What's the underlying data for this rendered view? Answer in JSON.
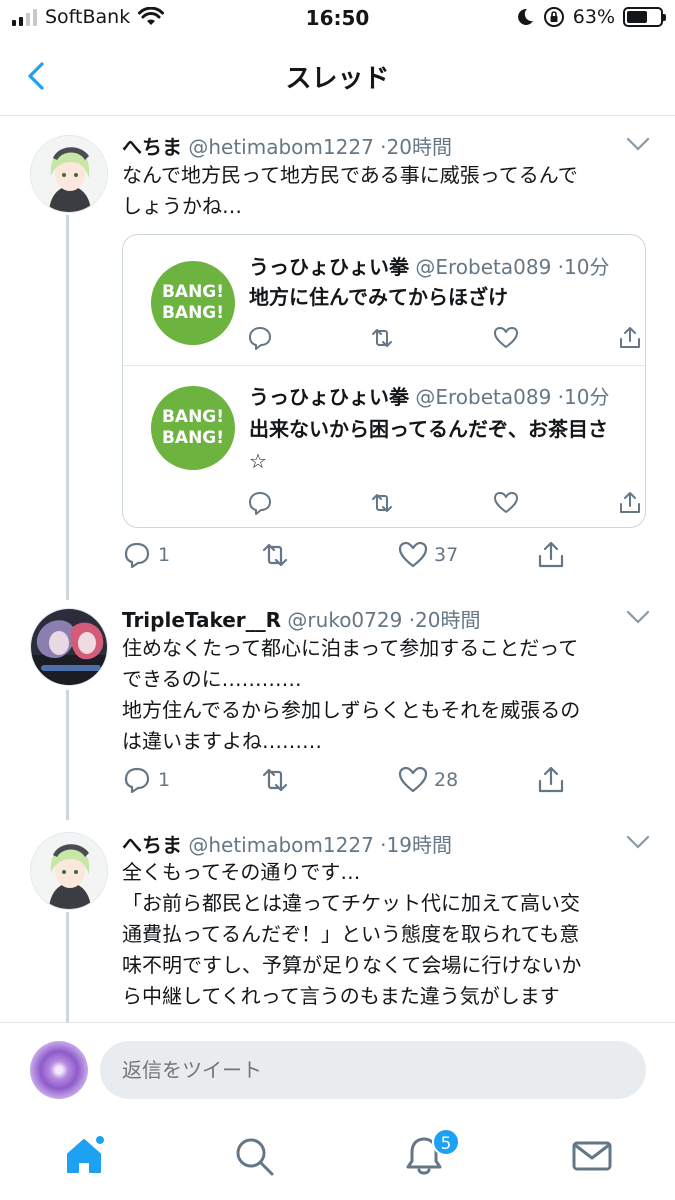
{
  "status_bar": {
    "carrier": "SoftBank",
    "time": "16:50",
    "battery": "63%",
    "battery_level": 0.63
  },
  "nav": {
    "title": "スレッド"
  },
  "tweets": [
    {
      "name": "へちま",
      "handle": "@hetimabom1227",
      "time": "20時間",
      "lines": [
        "なんで地方民って地方民である事に威張ってるんで",
        "しょうかね…"
      ],
      "replies": "1",
      "likes": "37",
      "quotes": [
        {
          "avatar_text": [
            "BANG!",
            "BANG!"
          ],
          "name": "うっひょひょい拳",
          "handle": "@Erobeta089",
          "time": "10分",
          "lines": [
            "地方に住んでみてからほざけ"
          ]
        },
        {
          "avatar_text": [
            "BANG!",
            "BANG!"
          ],
          "name": "うっひょひょい拳",
          "handle": "@Erobeta089",
          "time": "10分",
          "lines": [
            "出来ないから困ってるんだぞ、お茶目さ",
            "☆"
          ]
        }
      ]
    },
    {
      "name": "TripleTaker__R",
      "handle": "@ruko0729",
      "time": "20時間",
      "lines": [
        "住めなくたって都心に泊まって参加することだって",
        "できるのに…………",
        "地方住んでるから参加しずらくともそれを威張るの",
        "は違いますよね………"
      ],
      "replies": "1",
      "likes": "28"
    },
    {
      "name": "へちま",
      "handle": "@hetimabom1227",
      "time": "19時間",
      "lines": [
        "全くもってその通りです…",
        "「お前ら都民とは違ってチケット代に加えて高い交",
        "通費払ってるんだぞ！」という態度を取られても意",
        "味不明ですし、予算が足りなくて会場に行けないか",
        "ら中継してくれって言うのもまた違う気がします"
      ]
    }
  ],
  "reply": {
    "placeholder": "返信をツイート"
  },
  "tab_bar": {
    "items": [
      "home-icon",
      "search-icon",
      "notifications-icon",
      "messages-icon"
    ],
    "notification_badge": "5"
  },
  "colors": {
    "accent": "#1da1f2",
    "secondary_text": "#657786",
    "border": "#e1e8ed",
    "quote_avatar": "#6db33f"
  }
}
